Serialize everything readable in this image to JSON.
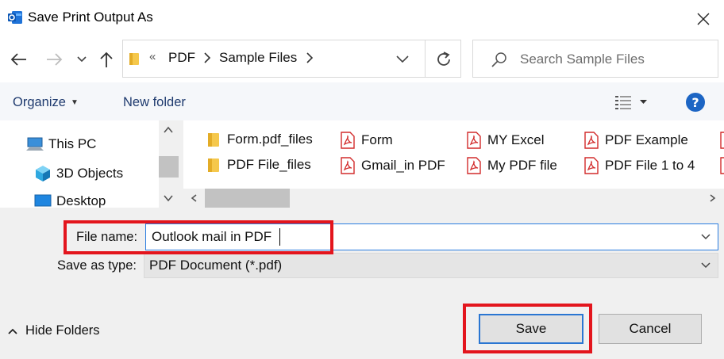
{
  "window": {
    "title": "Save Print Output As",
    "icon": "outlook-icon"
  },
  "address": {
    "overflow": "«",
    "breadcrumbs": [
      "PDF",
      "Sample Files"
    ]
  },
  "search": {
    "placeholder": "Search Sample Files"
  },
  "toolbar": {
    "organize_label": "Organize",
    "new_folder_label": "New folder",
    "help_label": "?"
  },
  "nav": {
    "items": [
      {
        "label": "This PC",
        "icon": "computer-icon"
      },
      {
        "label": "3D Objects",
        "icon": "cube-icon"
      },
      {
        "label": "Desktop",
        "icon": "desktop-icon"
      }
    ]
  },
  "files": [
    {
      "name": "Form.pdf_files",
      "type": "folder"
    },
    {
      "name": "PDF File_files",
      "type": "folder"
    },
    {
      "name": "Form",
      "type": "pdf"
    },
    {
      "name": "Gmail_in PDF",
      "type": "pdf"
    },
    {
      "name": "MY Excel",
      "type": "pdf"
    },
    {
      "name": "My PDF file",
      "type": "pdf"
    },
    {
      "name": "PDF Example",
      "type": "pdf"
    },
    {
      "name": "PDF File 1 to 4",
      "type": "pdf"
    }
  ],
  "form": {
    "file_name_label": "File name:",
    "file_name_value": "Outlook mail in PDF",
    "save_type_label": "Save as type:",
    "save_type_value": "PDF Document (*.pdf)",
    "hide_folders_label": "Hide Folders",
    "save_label": "Save",
    "cancel_label": "Cancel"
  },
  "colors": {
    "accent": "#2a76d2",
    "highlight": "#e3151d",
    "pdf_red": "#d22b2b",
    "folder_yellow": "#f5c84c"
  }
}
